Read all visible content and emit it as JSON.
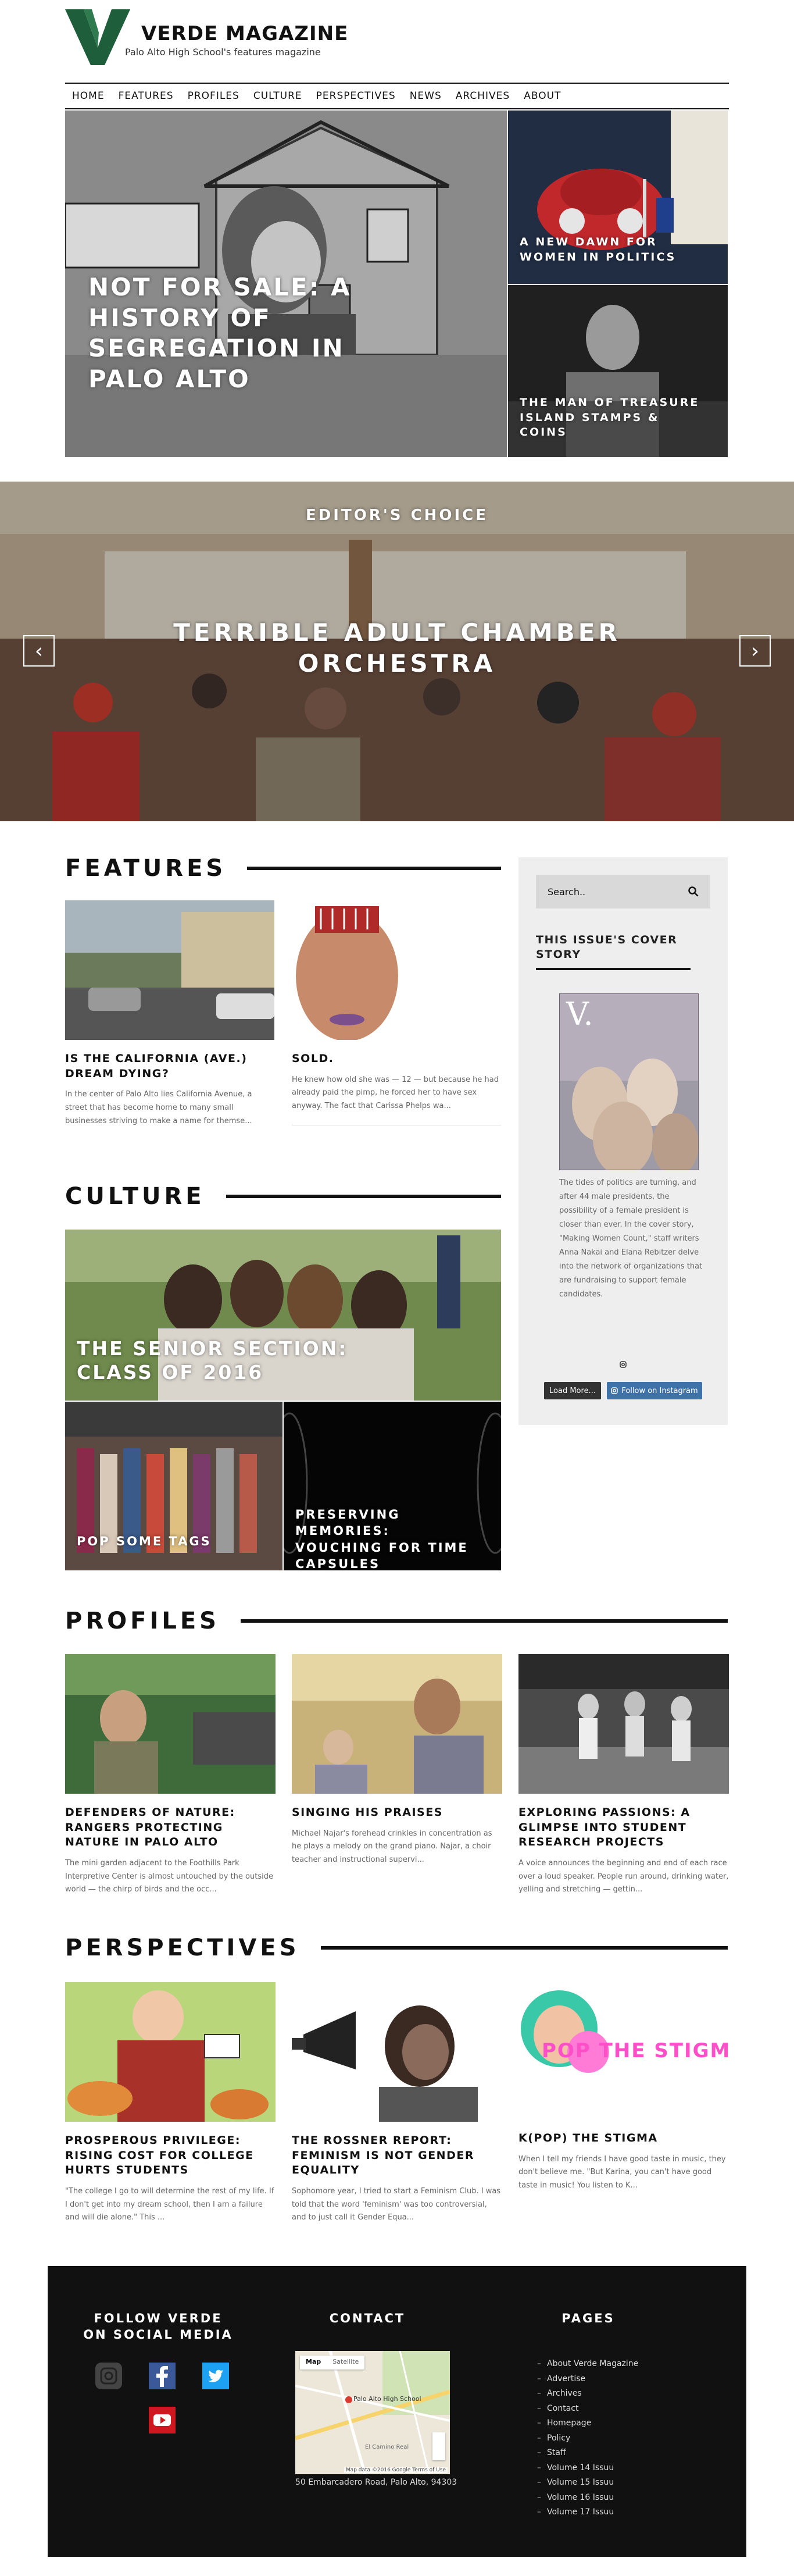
{
  "brand": {
    "title": "VERDE MAGAZINE",
    "subtitle": "Palo Alto High School's features magazine",
    "logo_letter": "V",
    "green": "#1f5e3a"
  },
  "nav": [
    "HOME",
    "FEATURES",
    "PROFILES",
    "CULTURE",
    "PERSPECTIVES",
    "NEWS",
    "ARCHIVES",
    "ABOUT"
  ],
  "hero": {
    "main": "NOT FOR SALE: A HISTORY OF SEGREGATION IN PALO ALTO",
    "top_right": "A NEW DAWN FOR WOMEN IN POLITICS",
    "bottom_right": "THE MAN OF TREASURE ISLAND STAMPS & COINS"
  },
  "banner": {
    "kicker": "EDITOR'S CHOICE",
    "title": "TERRIBLE ADULT CHAMBER ORCHESTRA",
    "prev": "‹",
    "next": "›"
  },
  "features": {
    "heading": "FEATURES",
    "cards": [
      {
        "title": "IS THE CALIFORNIA (AVE.) DREAM DYING?",
        "excerpt": "In the center of Palo Alto lies California Avenue, a street that has become home to many small businesses striving to make a name for themse..."
      },
      {
        "title": "SOLD.",
        "excerpt": "He knew how old she was — 12 — but because he had already paid the pimp, he forced her to have sex anyway. The fact that Carissa Phelps wa..."
      }
    ]
  },
  "sidebar": {
    "search_placeholder": "Search..",
    "cover_heading": "THIS ISSUE'S COVER STORY",
    "cover_letter": "V.",
    "cover_text": "The tides of politics are turning, and after 44 male presidents, the possibility of a female president is closer than ever. In the cover story, \"Making Women Count,\" staff writers Anna Nakai and Elana Rebitzer delve into the network of organizations that are fundraising to support female candidates.",
    "load_more": "Load More...",
    "instagram": "Follow on Instagram"
  },
  "culture": {
    "heading": "CULTURE",
    "main": "THE SENIOR SECTION: CLASS OF 2016",
    "left": "POP SOME TAGS",
    "right": "PRESERVING MEMORIES: VOUCHING FOR TIME CAPSULES"
  },
  "profiles": {
    "heading": "PROFILES",
    "cards": [
      {
        "title": "DEFENDERS OF NATURE: RANGERS PROTECTING NATURE IN PALO ALTO",
        "excerpt": "The mini garden adjacent to the Foothills Park Interpretive Center is almost untouched by the outside world — the chirp of birds and the occ..."
      },
      {
        "title": "SINGING HIS PRAISES",
        "excerpt": "Michael Najar's forehead crinkles in concentration as he plays a melody on the grand piano. Najar, a choir teacher and instructional supervi..."
      },
      {
        "title": "EXPLORING PASSIONS: A GLIMPSE INTO STUDENT RESEARCH PROJECTS",
        "excerpt": "A voice announces the beginning and end of each race over a loud speaker. People run around, drinking water, yelling and stretching — gettin..."
      }
    ]
  },
  "perspectives": {
    "heading": "PERSPECTIVES",
    "cards": [
      {
        "title": "PROSPEROUS PRIVILEGE: RISING COST FOR COLLEGE HURTS STUDENTS",
        "excerpt": "\"The college I go to will determine the rest of my life. If I don't get into my dream school, then I am a failure and will die alone.\" This ..."
      },
      {
        "title": "THE ROSSNER REPORT: FEMINISM IS NOT GENDER EQUALITY",
        "excerpt": "Sophomore year, I tried to start a Feminism Club. I was told that the word 'feminism' was too controversial, and to just call it Gender Equa..."
      },
      {
        "title": "K(POP) THE STIGMA",
        "excerpt": "When I tell my friends I have good taste in music, they don't believe me. \"But Karina, you can't have good taste in music! You listen to K..."
      }
    ],
    "kpop_art": "POP THE STIGMA"
  },
  "footer": {
    "social_heading": "FOLLOW VERDE ON SOCIAL MEDIA",
    "contact_heading": "CONTACT",
    "pages_heading": "PAGES",
    "map_tabs": [
      "Map",
      "Satellite"
    ],
    "map_label": "Palo Alto High School",
    "map_street": "El Camino Real",
    "map_credit": "Map data ©2016 Google  Terms of Use",
    "address": "50 Embarcadero Road, Palo Alto, 94303",
    "pages": [
      "About Verde Magazine",
      "Advertise",
      "Archives",
      "Contact",
      "Homepage",
      "Policy",
      "Staff",
      "Volume 14 Issuu",
      "Volume 15 Issuu",
      "Volume 16 Issuu",
      "Volume 17 Issuu"
    ],
    "social": [
      {
        "icon": "instagram-icon",
        "color": "#444444"
      },
      {
        "icon": "facebook-icon",
        "color": "#3b5998"
      },
      {
        "icon": "twitter-icon",
        "color": "#1da1f2"
      },
      {
        "icon": "youtube-icon",
        "color": "#cc181e"
      }
    ]
  }
}
